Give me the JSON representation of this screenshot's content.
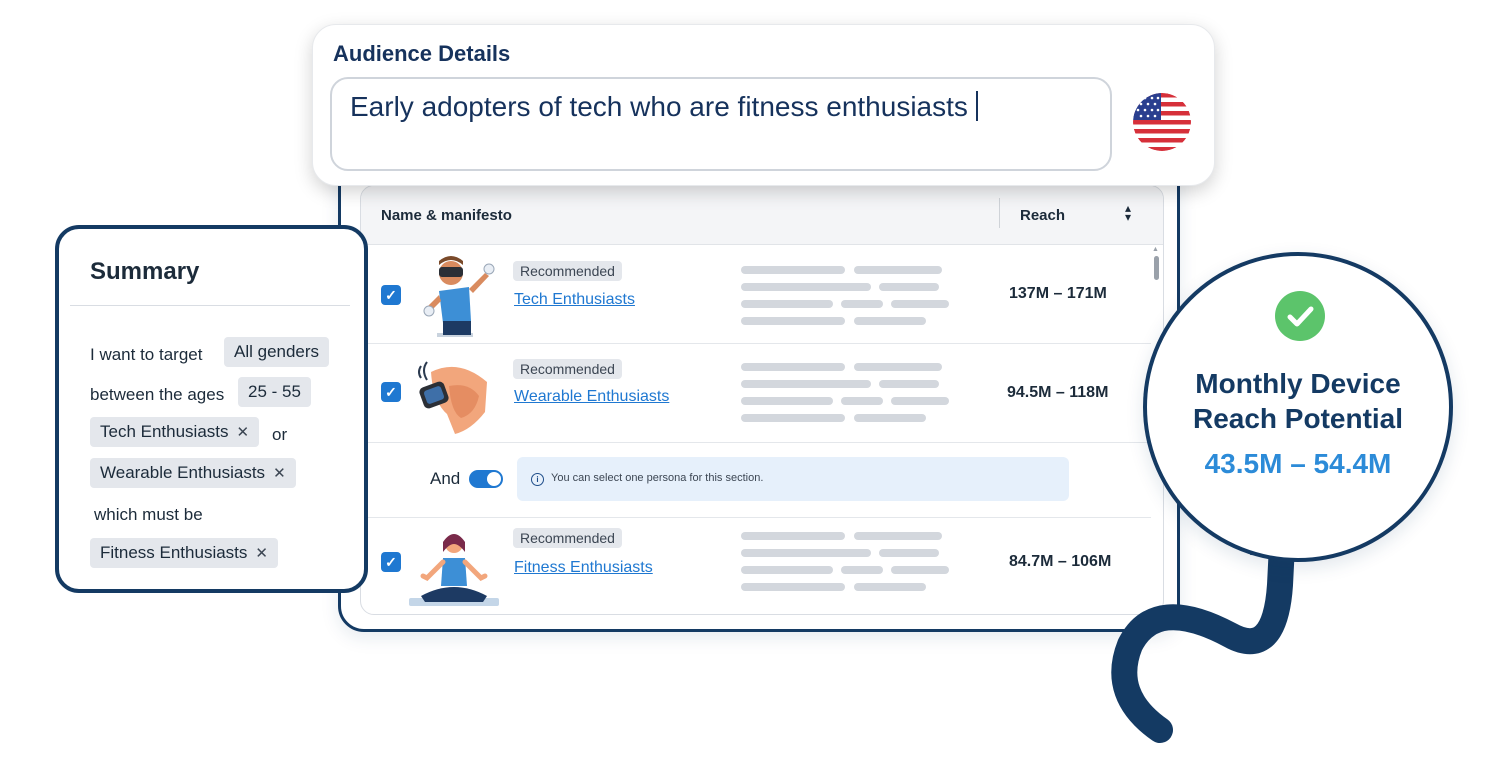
{
  "audience_details": {
    "title": "Audience Details",
    "input_value": "Early adopters of tech who are fitness enthusiasts",
    "country_flag": "us-flag-icon"
  },
  "table": {
    "header": {
      "name_label": "Name & manifesto",
      "reach_label": "Reach",
      "sort_icon": "sort-icon"
    },
    "rows": [
      {
        "checked": true,
        "tag": "Recommended",
        "name": "Tech Enthusiasts",
        "reach": "137M – 171M",
        "illustration": "vr-headset-person"
      },
      {
        "checked": true,
        "tag": "Recommended",
        "name": "Wearable Enthusiasts",
        "reach": "94.5M – 118M",
        "illustration": "smartwatch-wrist"
      },
      {
        "checked": true,
        "tag": "Recommended",
        "name": "Fitness Enthusiasts",
        "reach": "84.7M – 106M",
        "illustration": "meditating-woman"
      }
    ],
    "and_row": {
      "label": "And",
      "toggle_on": true,
      "info_text": "You can select one persona for this section."
    }
  },
  "summary": {
    "title": "Summary",
    "line1_text": "I want to target",
    "genders_chip": "All genders",
    "line2_text": "between the ages",
    "ages_chip": "25 - 55",
    "chip_tech": "Tech Enthusiasts",
    "or_text": "or",
    "chip_wearable": "Wearable Enthusiasts",
    "must_text": "which must be",
    "chip_fitness": "Fitness Enthusiasts"
  },
  "reach_potential": {
    "title_line1": "Monthly Device",
    "title_line2": "Reach Potential",
    "value": "43.5M – 54.4M"
  },
  "colors": {
    "navy": "#143a63",
    "accent_blue": "#1f78d1",
    "value_blue": "#2c8bd8",
    "success_green": "#5cc46b"
  }
}
